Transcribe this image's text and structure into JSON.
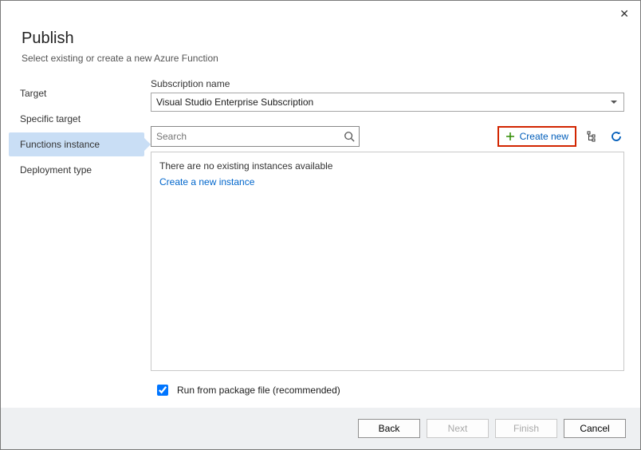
{
  "dialog": {
    "title": "Publish",
    "subtitle": "Select existing or create a new Azure Function"
  },
  "nav": {
    "items": [
      {
        "label": "Target",
        "active": false
      },
      {
        "label": "Specific target",
        "active": false
      },
      {
        "label": "Functions instance",
        "active": true
      },
      {
        "label": "Deployment type",
        "active": false
      }
    ]
  },
  "subscription": {
    "label": "Subscription name",
    "value": "Visual Studio Enterprise Subscription"
  },
  "search": {
    "placeholder": "Search"
  },
  "actions": {
    "create_new": "Create new"
  },
  "list": {
    "empty_message": "There are no existing instances available",
    "create_link": "Create a new instance"
  },
  "options": {
    "run_from_package": "Run from package file (recommended)",
    "run_from_package_checked": true
  },
  "footer": {
    "back": "Back",
    "next": "Next",
    "finish": "Finish",
    "cancel": "Cancel"
  }
}
